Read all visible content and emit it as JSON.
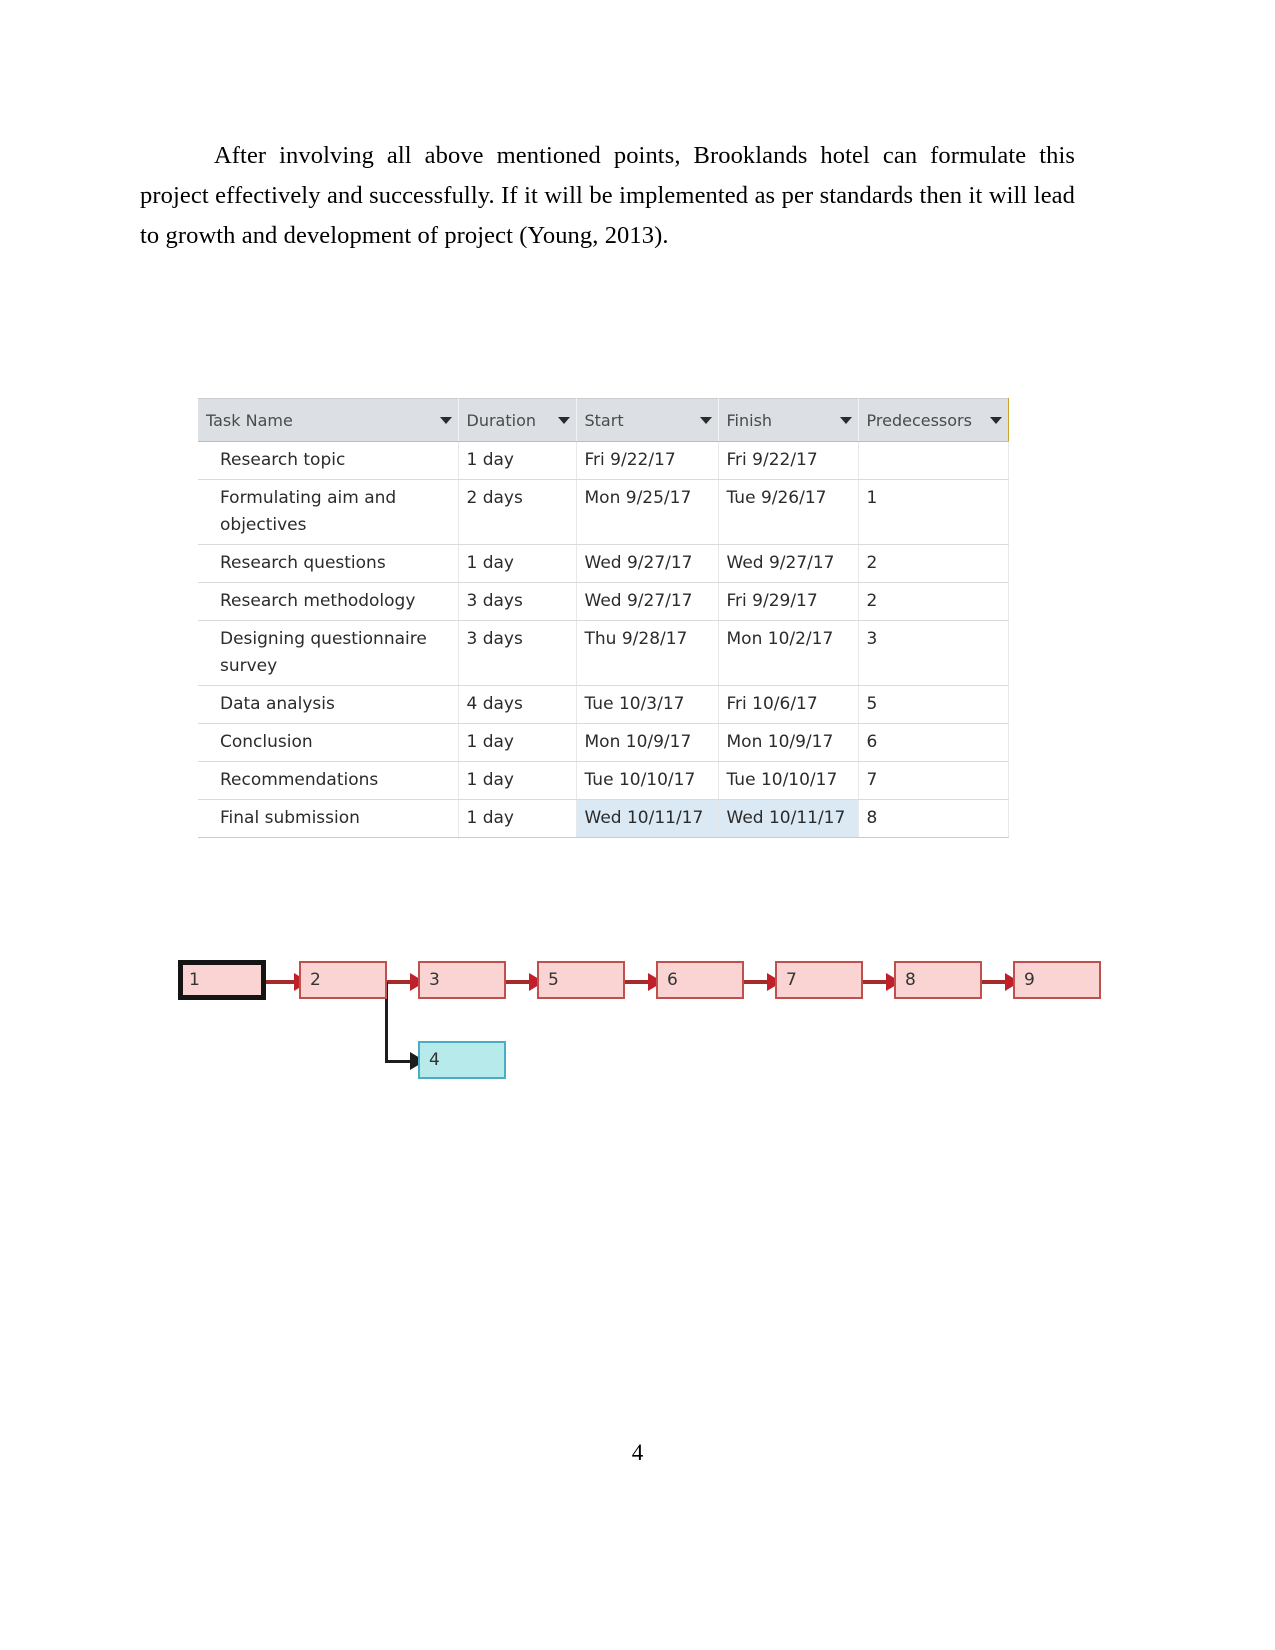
{
  "document": {
    "paragraph": "After involving all above mentioned points, Brooklands hotel can formulate this project effectively and successfully. If it will be implemented as per standards then it will lead to growth and development of project (Young, 2013).",
    "page_number": "4"
  },
  "task_table": {
    "columns": [
      {
        "label": "Task Name",
        "filter_icon": "chevron-down-icon"
      },
      {
        "label": "Duration",
        "filter_icon": "chevron-down-icon"
      },
      {
        "label": "Start",
        "filter_icon": "chevron-down-icon"
      },
      {
        "label": "Finish",
        "filter_icon": "chevron-down-icon"
      },
      {
        "label": "Predecessors",
        "filter_icon": "chevron-down-icon"
      }
    ],
    "rows": [
      {
        "task_name": "Research topic",
        "duration": "1 day",
        "start": "Fri 9/22/17",
        "finish": "Fri 9/22/17",
        "predecessors": ""
      },
      {
        "task_name": "Formulating aim and objectives",
        "duration": "2 days",
        "start": "Mon 9/25/17",
        "finish": "Tue 9/26/17",
        "predecessors": "1"
      },
      {
        "task_name": "Research questions",
        "duration": "1 day",
        "start": "Wed 9/27/17",
        "finish": "Wed 9/27/17",
        "predecessors": "2"
      },
      {
        "task_name": "Research methodology",
        "duration": "3 days",
        "start": "Wed 9/27/17",
        "finish": "Fri 9/29/17",
        "predecessors": "2"
      },
      {
        "task_name": "Designing questionnaire survey",
        "duration": "3 days",
        "start": "Thu 9/28/17",
        "finish": "Mon 10/2/17",
        "predecessors": "3"
      },
      {
        "task_name": "Data analysis",
        "duration": "4 days",
        "start": "Tue 10/3/17",
        "finish": "Fri 10/6/17",
        "predecessors": "5"
      },
      {
        "task_name": "Conclusion",
        "duration": "1 day",
        "start": "Mon 10/9/17",
        "finish": "Mon 10/9/17",
        "predecessors": "6"
      },
      {
        "task_name": "Recommendations",
        "duration": "1 day",
        "start": "Tue 10/10/17",
        "finish": "Tue 10/10/17",
        "predecessors": "7"
      },
      {
        "task_name": "Final submission",
        "duration": "1 day",
        "start": "Wed 10/11/17",
        "finish": "Wed 10/11/17",
        "predecessors": "8",
        "selected": true
      }
    ]
  },
  "network_diagram": {
    "main_chain": [
      "1",
      "2",
      "3",
      "5",
      "6",
      "7",
      "8",
      "9"
    ],
    "branch_node": "4",
    "branch_from": "2",
    "colors": {
      "node_fill": "#fad3d3",
      "node_border": "#c0504d",
      "branch_fill": "#b6eaeb",
      "branch_border": "#4bacc6",
      "connector": "#a52a2a",
      "arrowhead": "#c0202a",
      "start_border": "#141414"
    }
  }
}
